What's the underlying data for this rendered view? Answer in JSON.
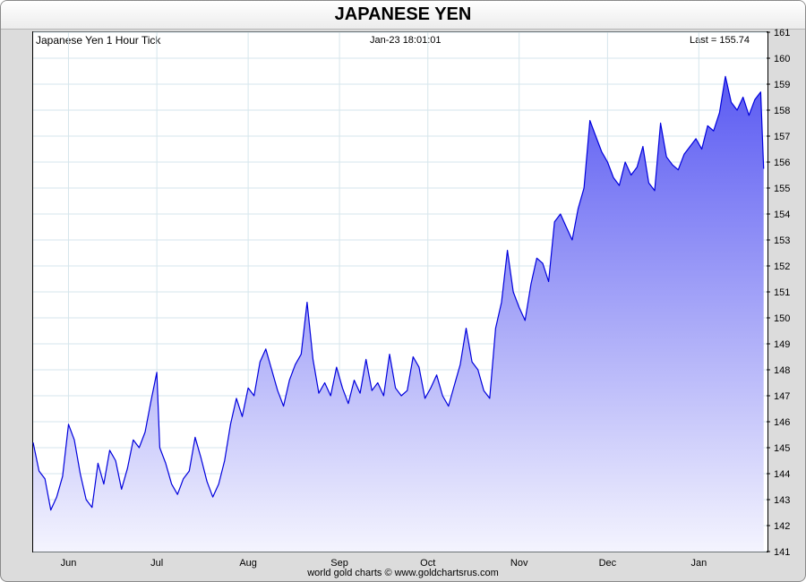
{
  "chart_data": {
    "type": "area",
    "title": "JAPANESE YEN",
    "subtitle": "Japanese Yen 1 Hour Tick",
    "timestamp": "Jan-23  18:01:01",
    "last_label": "Last = 155.74",
    "footer": "world gold charts © www.goldchartsrus.com",
    "ylim": [
      141,
      161
    ],
    "yticks": [
      141,
      142,
      143,
      144,
      145,
      146,
      147,
      148,
      149,
      150,
      151,
      152,
      153,
      154,
      155,
      156,
      157,
      158,
      159,
      160,
      161
    ],
    "x_start": "2024-05-20",
    "x_end": "2025-01-24",
    "xticks": [
      {
        "label": "Jun",
        "date": "2024-06-01"
      },
      {
        "label": "Jul",
        "date": "2024-07-01"
      },
      {
        "label": "Aug",
        "date": "2024-08-01"
      },
      {
        "label": "Sep",
        "date": "2024-09-01"
      },
      {
        "label": "Oct",
        "date": "2024-10-01"
      },
      {
        "label": "Nov",
        "date": "2024-11-01"
      },
      {
        "label": "Dec",
        "date": "2024-12-01"
      },
      {
        "label": "Jan",
        "date": "2025-01-01"
      }
    ],
    "series": [
      {
        "values": [
          [
            "2024-05-20",
            145.2
          ],
          [
            "2024-05-22",
            144.1
          ],
          [
            "2024-05-24",
            143.8
          ],
          [
            "2024-05-26",
            142.6
          ],
          [
            "2024-05-28",
            143.1
          ],
          [
            "2024-05-30",
            143.9
          ],
          [
            "2024-06-01",
            145.9
          ],
          [
            "2024-06-03",
            145.3
          ],
          [
            "2024-06-05",
            144.0
          ],
          [
            "2024-06-07",
            143.0
          ],
          [
            "2024-06-09",
            142.7
          ],
          [
            "2024-06-11",
            144.4
          ],
          [
            "2024-06-13",
            143.6
          ],
          [
            "2024-06-15",
            144.9
          ],
          [
            "2024-06-17",
            144.5
          ],
          [
            "2024-06-19",
            143.4
          ],
          [
            "2024-06-21",
            144.2
          ],
          [
            "2024-06-23",
            145.3
          ],
          [
            "2024-06-25",
            145.0
          ],
          [
            "2024-06-27",
            145.6
          ],
          [
            "2024-06-29",
            146.8
          ],
          [
            "2024-07-01",
            147.9
          ],
          [
            "2024-07-02",
            145.0
          ],
          [
            "2024-07-04",
            144.4
          ],
          [
            "2024-07-06",
            143.6
          ],
          [
            "2024-07-08",
            143.2
          ],
          [
            "2024-07-10",
            143.8
          ],
          [
            "2024-07-12",
            144.1
          ],
          [
            "2024-07-14",
            145.4
          ],
          [
            "2024-07-16",
            144.6
          ],
          [
            "2024-07-18",
            143.7
          ],
          [
            "2024-07-20",
            143.1
          ],
          [
            "2024-07-22",
            143.6
          ],
          [
            "2024-07-24",
            144.5
          ],
          [
            "2024-07-26",
            145.9
          ],
          [
            "2024-07-28",
            146.9
          ],
          [
            "2024-07-30",
            146.2
          ],
          [
            "2024-08-01",
            147.3
          ],
          [
            "2024-08-03",
            147.0
          ],
          [
            "2024-08-05",
            148.3
          ],
          [
            "2024-08-07",
            148.8
          ],
          [
            "2024-08-09",
            148.0
          ],
          [
            "2024-08-11",
            147.2
          ],
          [
            "2024-08-13",
            146.6
          ],
          [
            "2024-08-15",
            147.6
          ],
          [
            "2024-08-17",
            148.2
          ],
          [
            "2024-08-19",
            148.6
          ],
          [
            "2024-08-21",
            150.6
          ],
          [
            "2024-08-23",
            148.4
          ],
          [
            "2024-08-25",
            147.1
          ],
          [
            "2024-08-27",
            147.5
          ],
          [
            "2024-08-29",
            147.0
          ],
          [
            "2024-08-31",
            148.1
          ],
          [
            "2024-09-02",
            147.3
          ],
          [
            "2024-09-04",
            146.7
          ],
          [
            "2024-09-06",
            147.6
          ],
          [
            "2024-09-08",
            147.1
          ],
          [
            "2024-09-10",
            148.4
          ],
          [
            "2024-09-12",
            147.2
          ],
          [
            "2024-09-14",
            147.5
          ],
          [
            "2024-09-16",
            147.0
          ],
          [
            "2024-09-18",
            148.6
          ],
          [
            "2024-09-20",
            147.3
          ],
          [
            "2024-09-22",
            147.0
          ],
          [
            "2024-09-24",
            147.2
          ],
          [
            "2024-09-26",
            148.5
          ],
          [
            "2024-09-28",
            148.1
          ],
          [
            "2024-09-30",
            146.9
          ],
          [
            "2024-10-02",
            147.3
          ],
          [
            "2024-10-04",
            147.8
          ],
          [
            "2024-10-06",
            147.0
          ],
          [
            "2024-10-08",
            146.6
          ],
          [
            "2024-10-10",
            147.4
          ],
          [
            "2024-10-12",
            148.2
          ],
          [
            "2024-10-14",
            149.6
          ],
          [
            "2024-10-16",
            148.3
          ],
          [
            "2024-10-18",
            148.0
          ],
          [
            "2024-10-20",
            147.2
          ],
          [
            "2024-10-22",
            146.9
          ],
          [
            "2024-10-24",
            149.6
          ],
          [
            "2024-10-26",
            150.6
          ],
          [
            "2024-10-28",
            152.6
          ],
          [
            "2024-10-30",
            151.0
          ],
          [
            "2024-11-01",
            150.4
          ],
          [
            "2024-11-03",
            149.9
          ],
          [
            "2024-11-05",
            151.3
          ],
          [
            "2024-11-07",
            152.3
          ],
          [
            "2024-11-09",
            152.1
          ],
          [
            "2024-11-11",
            151.4
          ],
          [
            "2024-11-13",
            153.7
          ],
          [
            "2024-11-15",
            154.0
          ],
          [
            "2024-11-17",
            153.5
          ],
          [
            "2024-11-19",
            153.0
          ],
          [
            "2024-11-21",
            154.2
          ],
          [
            "2024-11-23",
            155.0
          ],
          [
            "2024-11-25",
            157.6
          ],
          [
            "2024-11-27",
            157.0
          ],
          [
            "2024-11-29",
            156.4
          ],
          [
            "2024-12-01",
            156.0
          ],
          [
            "2024-12-03",
            155.4
          ],
          [
            "2024-12-05",
            155.1
          ],
          [
            "2024-12-07",
            156.0
          ],
          [
            "2024-12-09",
            155.5
          ],
          [
            "2024-12-11",
            155.8
          ],
          [
            "2024-12-13",
            156.6
          ],
          [
            "2024-12-15",
            155.2
          ],
          [
            "2024-12-17",
            154.9
          ],
          [
            "2024-12-19",
            157.5
          ],
          [
            "2024-12-21",
            156.2
          ],
          [
            "2024-12-23",
            155.9
          ],
          [
            "2024-12-25",
            155.7
          ],
          [
            "2024-12-27",
            156.3
          ],
          [
            "2024-12-29",
            156.6
          ],
          [
            "2024-12-31",
            156.9
          ],
          [
            "2025-01-02",
            156.5
          ],
          [
            "2025-01-04",
            157.4
          ],
          [
            "2025-01-06",
            157.2
          ],
          [
            "2025-01-08",
            157.9
          ],
          [
            "2025-01-10",
            159.3
          ],
          [
            "2025-01-12",
            158.3
          ],
          [
            "2025-01-14",
            158.0
          ],
          [
            "2025-01-16",
            158.5
          ],
          [
            "2025-01-18",
            157.8
          ],
          [
            "2025-01-20",
            158.4
          ],
          [
            "2025-01-22",
            158.7
          ],
          [
            "2025-01-23",
            155.74
          ]
        ]
      }
    ],
    "colors": {
      "line": "#0000dd",
      "fill_top": "#5a5af2",
      "fill_bottom": "#f4f4fe",
      "grid": "#d6e6ec"
    },
    "grid": true
  }
}
